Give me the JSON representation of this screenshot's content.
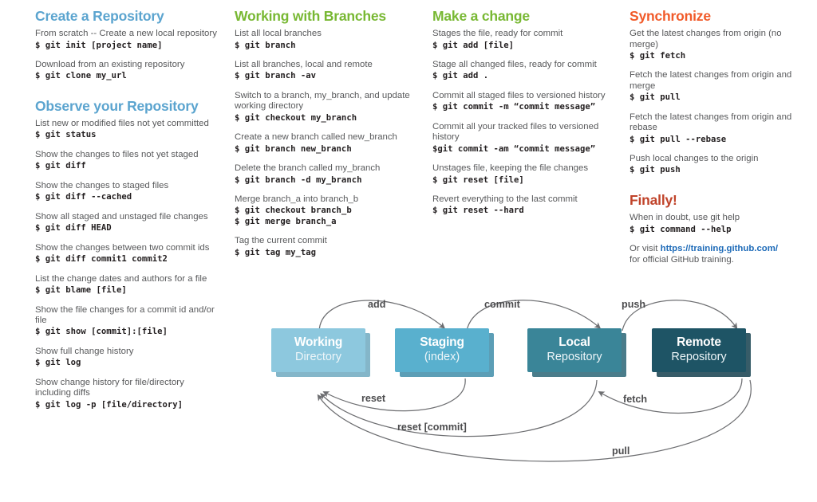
{
  "colors": {
    "blue": "#5ba4cf",
    "green": "#78b833",
    "orange": "#f15a29",
    "red": "#c0432a",
    "link": "#1e6bb8",
    "body_text": "#58595b",
    "command_text": "#231f20",
    "node_working": "#8dc8de",
    "node_staging": "#59b0ce",
    "node_local": "#3a8598",
    "node_remote": "#1e5465",
    "arrow": "#6d6e71"
  },
  "sections": [
    {
      "id": "create-a-repository",
      "title": "Create a Repository",
      "color": "blue",
      "entries": [
        {
          "desc": "From scratch -- Create a new local repository",
          "commands": [
            "$ git init [project name]"
          ]
        },
        {
          "desc": "Download from an existing repository",
          "commands": [
            "$ git clone my_url"
          ]
        }
      ]
    },
    {
      "id": "observe-your-repository",
      "title": "Observe your Repository",
      "color": "blue",
      "entries": [
        {
          "desc": "List new or modified files not yet committed",
          "commands": [
            "$ git status"
          ]
        },
        {
          "desc": "Show the changes to files not yet staged",
          "commands": [
            "$ git diff"
          ]
        },
        {
          "desc": "Show the changes to staged files",
          "commands": [
            "$ git diff --cached"
          ]
        },
        {
          "desc": "Show all staged and unstaged file changes",
          "commands": [
            "$ git diff HEAD"
          ]
        },
        {
          "desc": "Show the changes between two commit ids",
          "commands": [
            "$ git diff commit1 commit2"
          ]
        },
        {
          "desc": "List the change dates and authors for a file",
          "commands": [
            "$ git blame [file]"
          ]
        },
        {
          "desc": "Show the file changes for a commit id and/or file",
          "commands": [
            "$ git show [commit]:[file]"
          ]
        },
        {
          "desc": "Show full change history",
          "commands": [
            "$ git log"
          ]
        },
        {
          "desc": "Show change history for file/directory including diffs",
          "commands": [
            "$ git log -p [file/directory]"
          ]
        }
      ]
    },
    {
      "id": "working-with-branches",
      "title": "Working with Branches",
      "color": "green",
      "entries": [
        {
          "desc": "List all local branches",
          "commands": [
            "$ git branch"
          ]
        },
        {
          "desc": "List all branches, local and remote",
          "commands": [
            "$ git branch -av"
          ]
        },
        {
          "desc": "Switch to a branch, my_branch, and update working directory",
          "commands": [
            "$ git checkout my_branch"
          ]
        },
        {
          "desc": "Create a new branch called new_branch",
          "commands": [
            "$ git branch new_branch"
          ]
        },
        {
          "desc": "Delete the branch called my_branch",
          "commands": [
            "$ git branch -d my_branch"
          ]
        },
        {
          "desc": "Merge branch_a into branch_b",
          "commands": [
            "$ git checkout branch_b",
            "$ git merge branch_a"
          ]
        },
        {
          "desc": "Tag the current commit",
          "commands": [
            "$ git tag my_tag"
          ]
        }
      ]
    },
    {
      "id": "make-a-change",
      "title": "Make a change",
      "color": "green",
      "entries": [
        {
          "desc": "Stages the file, ready for commit",
          "commands": [
            "$ git add [file]"
          ]
        },
        {
          "desc": "Stage all changed files, ready for commit",
          "commands": [
            "$ git add ."
          ]
        },
        {
          "desc": "Commit all staged files to versioned history",
          "commands": [
            "$ git commit -m “commit message”"
          ]
        },
        {
          "desc": "Commit all your tracked files to versioned history",
          "commands": [
            "$git commit -am “commit message”"
          ]
        },
        {
          "desc": "Unstages file, keeping the file changes",
          "commands": [
            "$ git reset [file]"
          ]
        },
        {
          "desc": "Revert everything to the last commit",
          "commands": [
            "$ git reset --hard"
          ]
        }
      ]
    },
    {
      "id": "synchronize",
      "title": "Synchronize",
      "color": "orange",
      "entries": [
        {
          "desc": "Get the latest changes from origin (no merge)",
          "commands": [
            "$ git fetch"
          ]
        },
        {
          "desc": "Fetch the latest changes from origin and merge",
          "commands": [
            "$ git pull"
          ]
        },
        {
          "desc": "Fetch the latest changes from origin and rebase",
          "commands": [
            "$ git pull --rebase"
          ]
        },
        {
          "desc": "Push local changes to the origin",
          "commands": [
            "$ git push"
          ]
        }
      ]
    },
    {
      "id": "finally",
      "title": "Finally!",
      "color": "red",
      "entries": [
        {
          "desc": "When in doubt, use git help",
          "commands": [
            "$ git command --help"
          ]
        }
      ],
      "footer": {
        "prefix": "Or visit ",
        "link": "https://training.github.com/",
        "suffix": "for official GitHub training."
      }
    }
  ],
  "diagram": {
    "nodes": [
      {
        "id": "working",
        "top": "Working",
        "sub": "Directory",
        "color": "#8dc8de",
        "shadow": "#6fa9bf"
      },
      {
        "id": "staging",
        "top": "Staging",
        "sub": "(index)",
        "color": "#59b0ce",
        "shadow": "#3f8da9"
      },
      {
        "id": "local",
        "top": "Local",
        "sub": "Repository",
        "color": "#3a8598",
        "shadow": "#2a6576"
      },
      {
        "id": "remote",
        "top": "Remote",
        "sub": "Repository",
        "color": "#1e5465",
        "shadow": "#143f4d"
      }
    ],
    "edges": [
      {
        "id": "add",
        "label": "add"
      },
      {
        "id": "commit",
        "label": "commit"
      },
      {
        "id": "push",
        "label": "push"
      },
      {
        "id": "reset",
        "label": "reset"
      },
      {
        "id": "fetch",
        "label": "fetch"
      },
      {
        "id": "reset-commit",
        "label": "reset [commit]"
      },
      {
        "id": "pull",
        "label": "pull"
      }
    ]
  }
}
